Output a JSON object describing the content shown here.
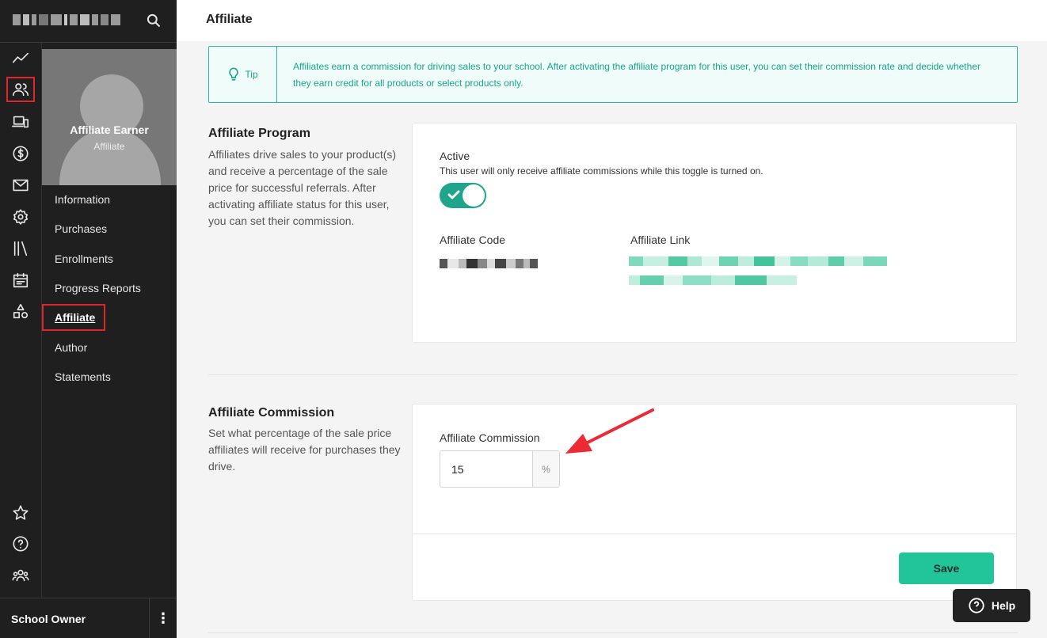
{
  "header": {
    "title": "Affiliate"
  },
  "owner": {
    "name": "School Owner",
    "more_label": "⋮"
  },
  "profile": {
    "name": "Affiliate Earner",
    "role": "Affiliate"
  },
  "subnav": {
    "items": [
      {
        "label": "Information"
      },
      {
        "label": "Purchases"
      },
      {
        "label": "Enrollments"
      },
      {
        "label": "Progress Reports"
      },
      {
        "label": "Affiliate"
      },
      {
        "label": "Author"
      },
      {
        "label": "Statements"
      }
    ]
  },
  "rail_icons": [
    "analytics-icon",
    "users-icon",
    "devices-icon",
    "dollar-icon",
    "mail-icon",
    "settings-icon",
    "library-icon",
    "calendar-icon",
    "shapes-icon",
    "star-icon",
    "help-circle-icon",
    "community-icon"
  ],
  "tip": {
    "label": "Tip",
    "text": "Affiliates earn a commission for driving sales to your school. After activating the affiliate program for this user, you can set their commission rate and decide whether they earn credit for all products or select products only."
  },
  "affiliate_program": {
    "title": "Affiliate Program",
    "description": "Affiliates drive sales to your product(s) and receive a percentage of the sale price for successful referrals. After activating affiliate status for this user, you can set their commission.",
    "active_label": "Active",
    "active_help": "This user will only receive affiliate commissions while this toggle is turned on.",
    "active": true,
    "code_label": "Affiliate Code",
    "link_label": "Affiliate Link"
  },
  "affiliate_commission": {
    "title": "Affiliate Commission",
    "description": "Set what percentage of the sale price affiliates will receive for purchases they drive.",
    "field_label": "Affiliate Commission",
    "value": "15",
    "suffix": "%",
    "save_label": "Save"
  },
  "help": {
    "label": "Help"
  },
  "colors": {
    "accent": "#1ea58c",
    "save": "#22c59a",
    "highlight": "#e0262d",
    "sidebar": "#1f1f1f"
  }
}
